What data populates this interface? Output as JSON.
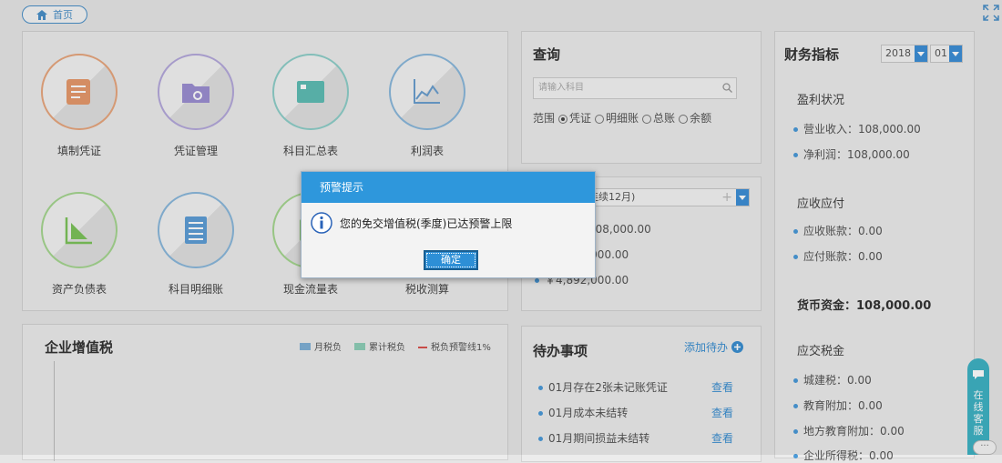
{
  "topbar": {
    "home_label": "首页"
  },
  "tiles": [
    {
      "label": "填制凭证"
    },
    {
      "label": "凭证管理"
    },
    {
      "label": "科目汇总表"
    },
    {
      "label": "利润表"
    },
    {
      "label": "资产负债表"
    },
    {
      "label": "科目明细账"
    },
    {
      "label": "现金流量表"
    },
    {
      "label": "税收测算"
    }
  ],
  "query": {
    "title": "查询",
    "placeholder": "请输入科目",
    "scope_label": "范围",
    "options": [
      "凭证",
      "明细账",
      "总账",
      "余额"
    ],
    "selected": "凭证"
  },
  "summary": {
    "select_value": "连续12月)",
    "row1": "发生：￥108,000.00",
    "row2": "￥5,000,000.00",
    "row3": "￥4,892,000.00"
  },
  "vat": {
    "title": "企业增值税",
    "legend": [
      {
        "label": "月税负",
        "color": "#7fb0d6"
      },
      {
        "label": "累计税负",
        "color": "#8fcfb8"
      },
      {
        "label": "税负预警线1%",
        "color": "#d9534f"
      }
    ]
  },
  "todo": {
    "title": "待办事项",
    "add_label": "添加待办",
    "items": [
      {
        "text": "01月存在2张未记账凭证",
        "action": "查看"
      },
      {
        "text": "01月成本未结转",
        "action": "查看"
      },
      {
        "text": "01月期间损益未结转",
        "action": "查看"
      }
    ]
  },
  "finance": {
    "title": "财务指标",
    "year": "2018",
    "month": "01",
    "profit_title": "盈利状况",
    "revenue": "营业收入：108,000.00",
    "net_profit": "净利润：108,000.00",
    "ar_title": "应收应付",
    "receivable": "应收账款：0.00",
    "payable": "应付账款：0.00",
    "cash": "货币资金：108,000.00",
    "tax_title": "应交税金",
    "tax1": "城建税：0.00",
    "tax2": "教育附加：0.00",
    "tax3": "地方教育附加：0.00",
    "tax4": "企业所得税：0.00"
  },
  "dialog": {
    "title": "预警提示",
    "message": "您的免交增值税(季度)已达预警上限",
    "ok_label": "确定"
  },
  "service": {
    "label": "在线客服"
  }
}
